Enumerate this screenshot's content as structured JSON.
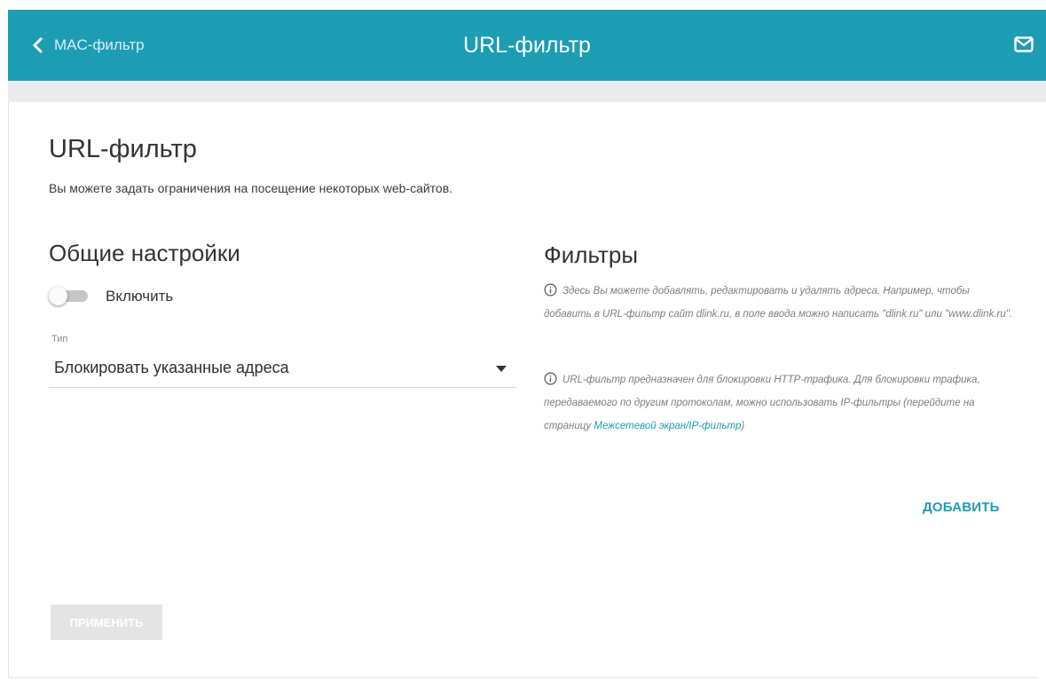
{
  "header": {
    "back_label": "MAC-фильтр",
    "title": "URL-фильтр",
    "accent_color": "#1d9db3"
  },
  "main": {
    "title": "URL-фильтр",
    "description": "Вы можете задать ограничения на посещение некоторых web-сайтов."
  },
  "general": {
    "heading": "Общие настройки",
    "enable_label": "Включить",
    "enable_on": false,
    "type_label": "Тип",
    "type_value": "Блокировать указанные адреса"
  },
  "filters": {
    "heading": "Фильтры",
    "info1": "Здесь Вы можете добавлять, редактировать и удалять адреса. Например, чтобы добавить в URL-фильтр сайт dlink.ru, в поле ввода можно написать \"dlink.ru\" или \"www.dlink.ru\".",
    "info2_prefix": "URL-фильтр предназначен для блокировки HTTP-трафика. Для блокировки трафика, передаваемого по другим протоколам, можно использовать IP-фильтры (перейдите на страницу",
    "info2_link": "Межсетевой экран/IP-фильтр",
    "info2_suffix": ")",
    "add_label": "ДОБАВИТЬ"
  },
  "apply_label": "ПРИМЕНИТЬ",
  "icons": [
    "chevron-left-icon",
    "mail-icon",
    "info-icon",
    "caret-down-icon"
  ]
}
